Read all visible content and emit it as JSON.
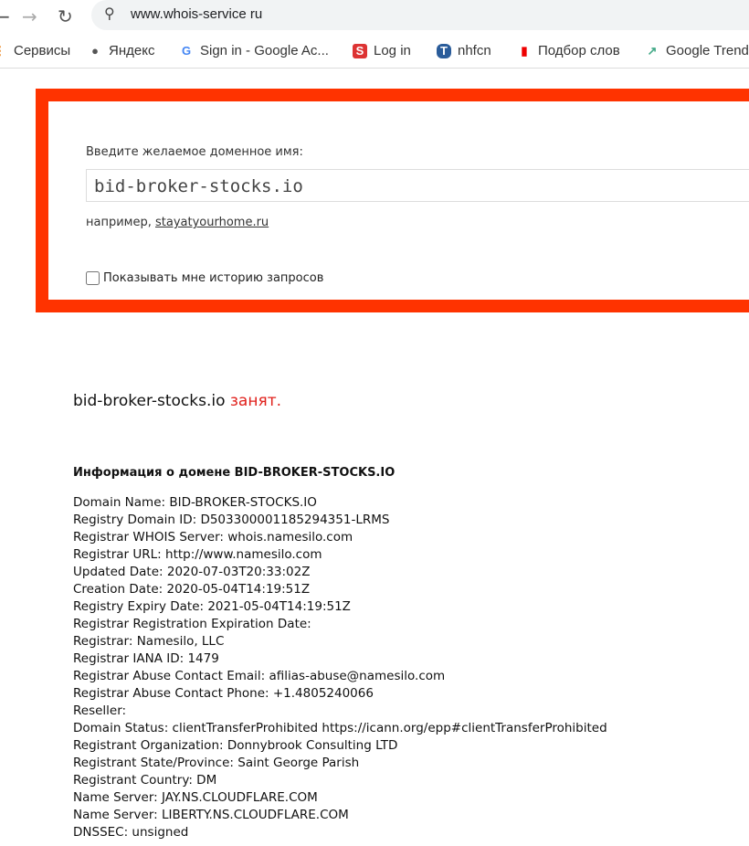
{
  "browser": {
    "url": "www.whois-service ru",
    "bookmarks": [
      {
        "label": "Сервисы",
        "icon": "apps-icon"
      },
      {
        "label": "Яндекс",
        "icon": "globe-icon"
      },
      {
        "label": "Sign in - Google Ac...",
        "icon": "google-icon"
      },
      {
        "label": "Log in",
        "icon": "site-icon"
      },
      {
        "label": "nhfcn",
        "icon": "shield-icon"
      },
      {
        "label": "Подбор слов",
        "icon": "bar-chart-icon"
      },
      {
        "label": "Google Trends",
        "icon": "trends-icon"
      }
    ]
  },
  "form": {
    "label": "Введите желаемое доменное имя:",
    "value": "bid-broker-stocks.io",
    "example_prefix": "например, ",
    "example_link": "stayatyourhome.ru",
    "history_label": "Показывать мне историю запросов"
  },
  "result": {
    "domain": "bid-broker-stocks.io",
    "status": "занят."
  },
  "info": {
    "heading": "Информация о домене BID-BROKER-STOCKS.IO",
    "lines": [
      "Domain Name: BID-BROKER-STOCKS.IO",
      "Registry Domain ID: D503300001185294351-LRMS",
      "Registrar WHOIS Server: whois.namesilo.com",
      "Registrar URL: http://www.namesilo.com",
      "Updated Date: 2020-07-03T20:33:02Z",
      "Creation Date: 2020-05-04T14:19:51Z",
      "Registry Expiry Date: 2021-05-04T14:19:51Z",
      "Registrar Registration Expiration Date:",
      "Registrar: Namesilo, LLC",
      "Registrar IANA ID: 1479",
      "Registrar Abuse Contact Email: afilias-abuse@namesilo.com",
      "Registrar Abuse Contact Phone: +1.4805240066",
      "Reseller:",
      "Domain Status: clientTransferProhibited https://icann.org/epp#clientTransferProhibited",
      "Registrant Organization: Donnybrook Consulting LTD",
      "Registrant State/Province: Saint George Parish",
      "Registrant Country: DM",
      "Name Server: JAY.NS.CLOUDFLARE.COM",
      "Name Server: LIBERTY.NS.CLOUDFLARE.COM",
      "DNSSEC: unsigned"
    ]
  }
}
